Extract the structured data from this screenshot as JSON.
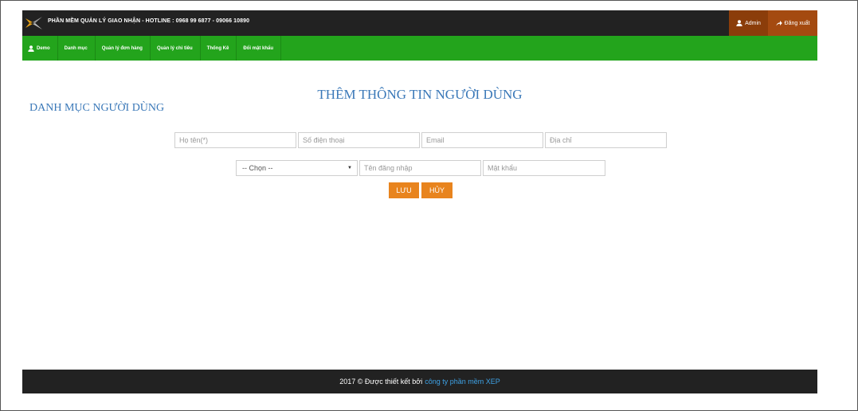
{
  "header": {
    "brand": "PHẦN MỀM QUẢN LÝ GIAO NHẬN  -  HOTLINE : 0968 99 6877 - 09066 10890",
    "admin_label": "Admin",
    "logout_label": "Đăng xuất",
    "colors": {
      "bar": "#222222",
      "admin": "#8b3d0a",
      "logout": "#a44a10"
    }
  },
  "menu": {
    "color": "#23a41c",
    "items": [
      {
        "label": "Demo",
        "icon": "user-icon"
      },
      {
        "label": "Danh mục"
      },
      {
        "label": "Quản lý đơn hàng"
      },
      {
        "label": "Quản lý chi tiêu"
      },
      {
        "label": "Thống Kê"
      },
      {
        "label": "Đổi mật khẩu"
      }
    ]
  },
  "main": {
    "page_title": "THÊM THÔNG TIN NGƯỜI DÙNG",
    "side_title": "DANH MỤC NGƯỜI DÙNG",
    "form": {
      "fullname_placeholder": "Họ tên(*)",
      "phone_placeholder": "Số điện thoại",
      "email_placeholder": "Email",
      "address_placeholder": "Địa chỉ",
      "role_selected": "-- Chọn --",
      "username_placeholder": "Tên đăng nhập",
      "password_placeholder": "Mật khẩu",
      "save_label": "LƯU",
      "cancel_label": "HỦY",
      "button_color": "#e8841e"
    }
  },
  "footer": {
    "text": "2017 © Được thiết kết bởi",
    "link_text": "công ty phần mềm XEP"
  }
}
